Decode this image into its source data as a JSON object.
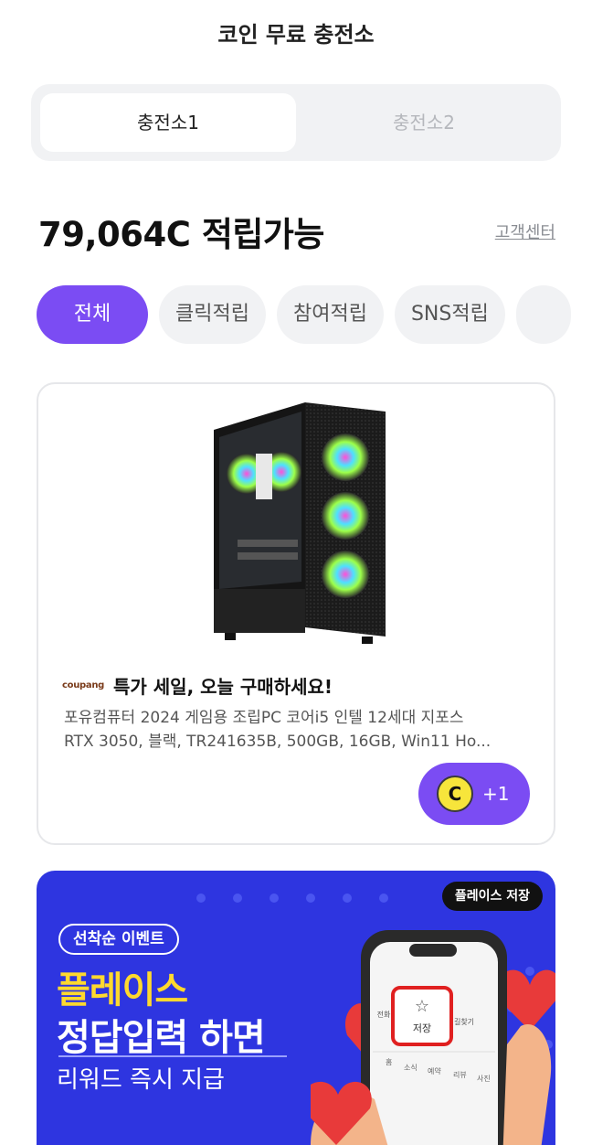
{
  "header": {
    "title": "코인 무료 충전소"
  },
  "tabs": [
    {
      "label": "충전소1",
      "active": true
    },
    {
      "label": "충전소2",
      "active": false
    }
  ],
  "balance": {
    "text": "79,064C 적립가능"
  },
  "support_link": "고객센터",
  "filters": [
    {
      "label": "전체",
      "active": true
    },
    {
      "label": "클릭적립",
      "active": false
    },
    {
      "label": "참여적립",
      "active": false
    },
    {
      "label": "SNS적립",
      "active": false
    }
  ],
  "product_card": {
    "brand": "coupang",
    "headline": "특가 세일, 오늘 구매하세요!",
    "description_line1": "포유컴퓨터 2024 게임용 조립PC 코어i5 인텔 12세대 지포스",
    "description_line2": "RTX 3050, 블랙, TR241635B, 500GB, 16GB, Win11 Ho...",
    "reward_coin": "C",
    "reward_amount": "+1"
  },
  "banner": {
    "tag": "플레이스 저장",
    "event_label": "선착순 이벤트",
    "line1": "플레이스",
    "line2": "정답입력 하면",
    "line3": "리워드 즉시 지급",
    "phone_save_label": "저장",
    "phone_tabs": [
      "홈",
      "소식",
      "예약",
      "리뷰",
      "사진"
    ],
    "phone_side_left": "전화",
    "phone_side_right": "길찾기"
  },
  "colors": {
    "accent": "#7b4cf3",
    "coin": "#f7e53b",
    "banner_bg": "#2e35e0",
    "banner_highlight": "#ffd92e"
  }
}
